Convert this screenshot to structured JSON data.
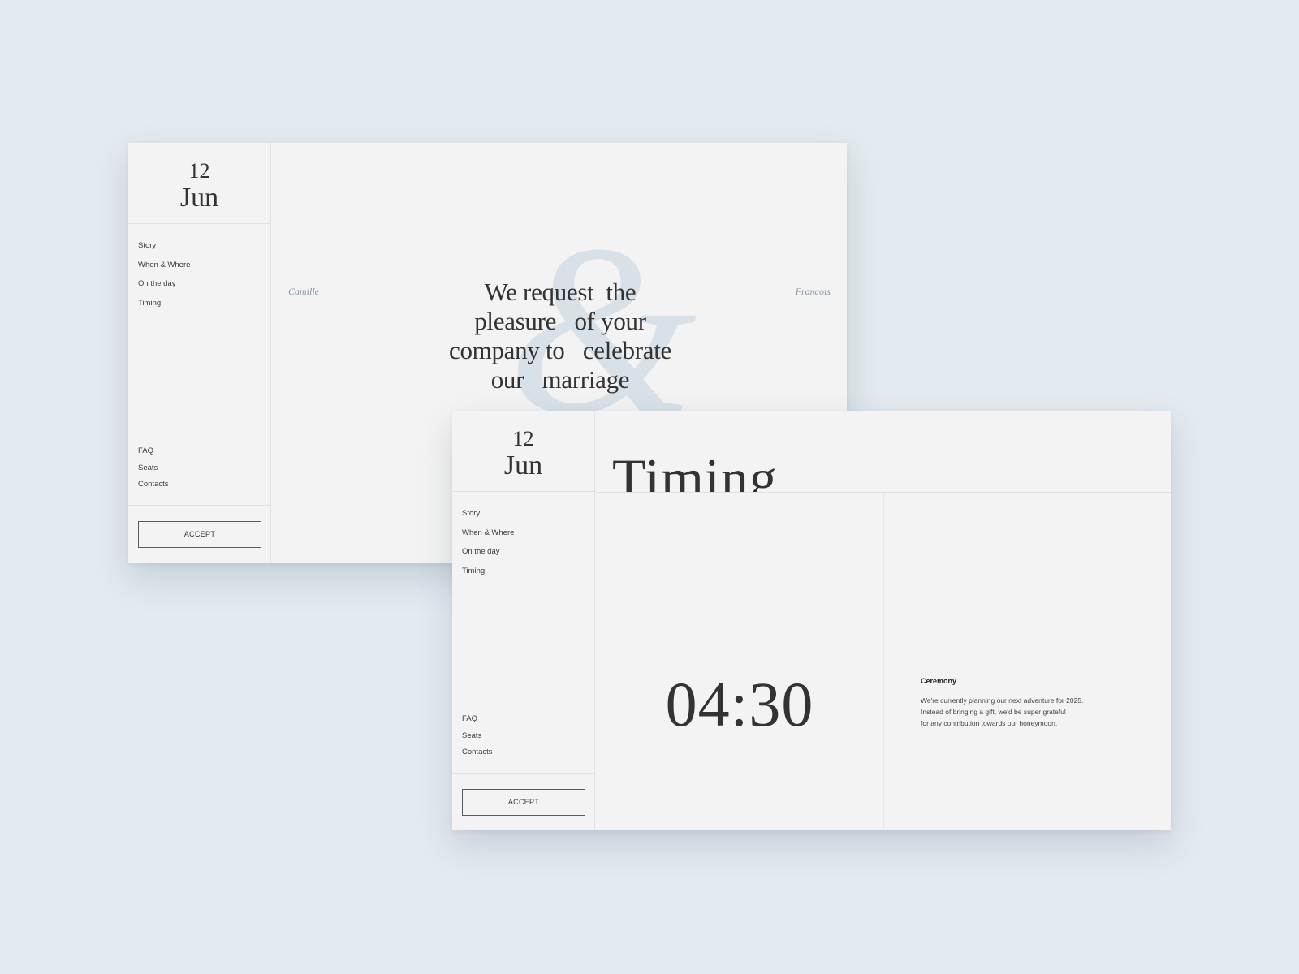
{
  "invitation_card": {
    "date": {
      "day": "12",
      "month": "Jun"
    },
    "nav_top": [
      "Story",
      "When & Where",
      "On the day",
      "Timing"
    ],
    "nav_bottom": [
      "FAQ",
      "Seats",
      "Contacts"
    ],
    "accept_label": "ACCEPT",
    "ampersand": "&",
    "name_left": "Camille",
    "name_right": "Francois",
    "message_lines": [
      "We request  the",
      "pleasure   of your",
      "company to   celebrate",
      "our   marriage"
    ]
  },
  "timing_card": {
    "date": {
      "day": "12",
      "month": "Jun"
    },
    "nav_top": [
      "Story",
      "When & Where",
      "On the day",
      "Timing"
    ],
    "nav_bottom": [
      "FAQ",
      "Seats",
      "Contacts"
    ],
    "accept_label": "ACCEPT",
    "title": "Timing",
    "time": "04:30",
    "event": {
      "title": "Ceremony",
      "text": "We're currently planning our next adventure for 2025.\nInstead of bringing a gift, we'd be super grateful\nfor any contribution towards our honeymoon."
    }
  },
  "colors": {
    "background": "#e3eaf0",
    "card": "#f3f3f3",
    "text": "#333333",
    "accent_names": "#8796a3",
    "ampersand": "#d8e1e8"
  }
}
